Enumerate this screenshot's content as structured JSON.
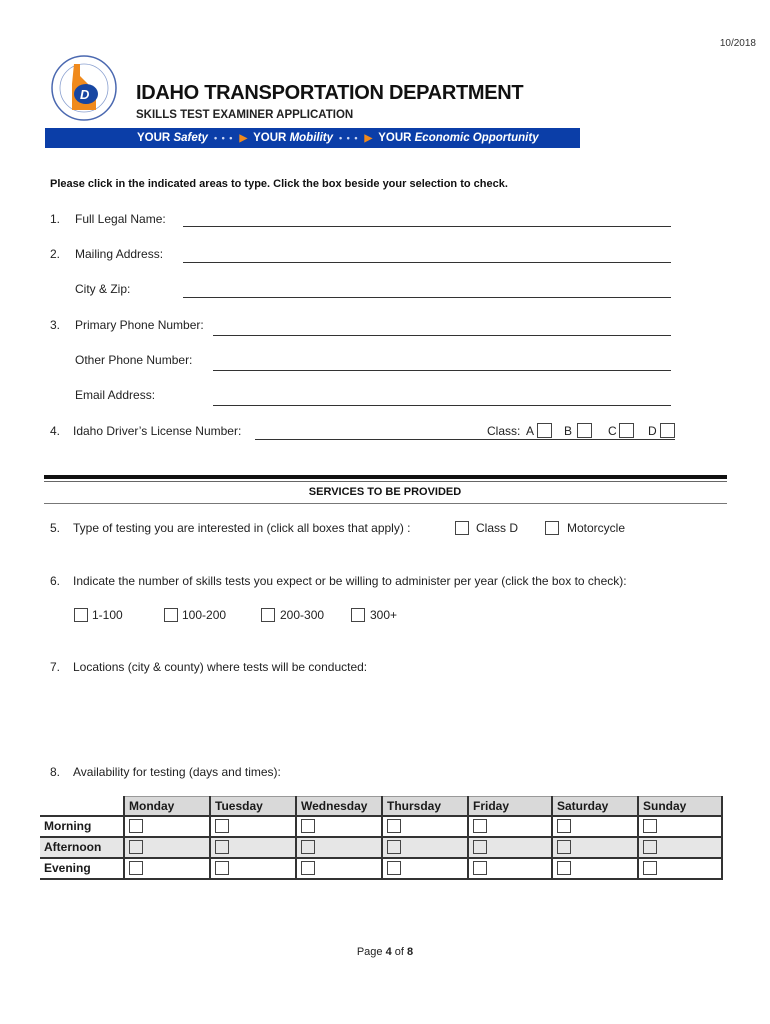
{
  "header": {
    "date": "10/2018",
    "org_title": "IDAHO TRANSPORTATION DEPARTMENT",
    "subtitle": "SKILLS TEST EXAMINER APPLICATION",
    "logo_text": "IDAHO TRANSPORTATION DEPARTMENT",
    "banner": {
      "items": [
        {
          "your": "YOUR",
          "word": "Safety"
        },
        {
          "your": "YOUR",
          "word": "Mobility"
        },
        {
          "your": "YOUR",
          "word": "Economic Opportunity"
        }
      ],
      "separator": "• • •",
      "colors": {
        "background": "#0b3ea8",
        "arrow": "#f08a1c"
      }
    }
  },
  "instructions": "Please click in the indicated areas to type. Click the box beside your selection to check.",
  "fields": {
    "q1": {
      "num": "1.",
      "label": "Full Legal Name:",
      "value": ""
    },
    "q2": {
      "num": "2.",
      "label": "Mailing Address:",
      "value": ""
    },
    "city_zip": {
      "label": "City & Zip:",
      "value": ""
    },
    "q3": {
      "num": "3.",
      "label": "Primary Phone Number:",
      "value": ""
    },
    "other_phone": {
      "label": "Other Phone Number:",
      "value": ""
    },
    "email": {
      "label": "Email Address:",
      "value": ""
    },
    "q4": {
      "num": "4.",
      "label": "Idaho Driver’s License Number:",
      "value": "",
      "class_label": "Class:",
      "classes": [
        "A",
        "B",
        "C",
        "D"
      ]
    }
  },
  "services": {
    "heading": "SERVICES TO BE PROVIDED",
    "q5": {
      "num": "5.",
      "label": "Type of testing you are interested in (click all boxes that apply) :",
      "options": [
        "Class D",
        "Motorcycle"
      ]
    },
    "q6": {
      "num": "6.",
      "label": "Indicate the number of skills tests you expect or be willing to administer per year (click the box to check):",
      "options": [
        "1-100",
        "100-200",
        "200-300",
        "300+"
      ]
    },
    "q7": {
      "num": "7.",
      "label": "Locations (city & county) where tests will be conducted:",
      "value": ""
    },
    "q8": {
      "num": "8.",
      "label": "Availability for testing (days and times):",
      "days": [
        "Monday",
        "Tuesday",
        "Wednesday",
        "Thursday",
        "Friday",
        "Saturday",
        "Sunday"
      ],
      "times": [
        "Morning",
        "Afternoon",
        "Evening"
      ]
    }
  },
  "footer": {
    "page_prefix": "Page",
    "page": "4",
    "of": "of",
    "total": "8"
  }
}
